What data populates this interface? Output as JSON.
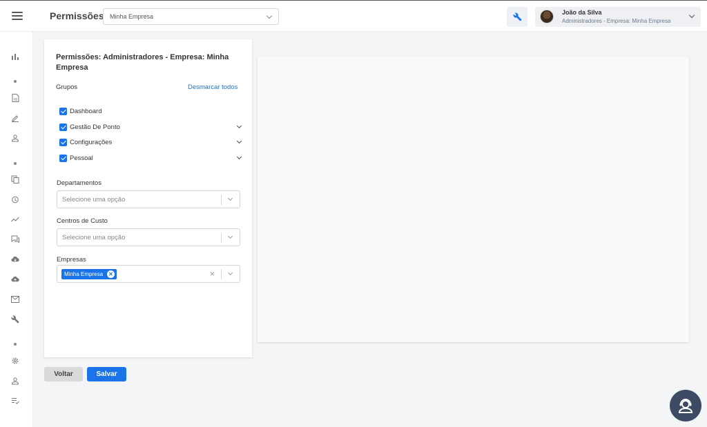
{
  "header": {
    "title": "Permissões",
    "company_select": "Minha Empresa",
    "user": {
      "name": "João da Silva",
      "role": "Administradores - Empresa: Minha Empresa"
    }
  },
  "sidebar": {
    "icons": [
      "chart-icon",
      "document-icon",
      "pencil-icon",
      "person-icon",
      "copy-icon",
      "alarm-icon",
      "trend-icon",
      "chat-icon",
      "cloud-download-icon",
      "cloud-upload-icon",
      "mail-icon",
      "wrench-icon",
      "gear-icon",
      "user-icon",
      "list-check-icon"
    ]
  },
  "card": {
    "title": "Permissões: Administradores - Empresa: Minha Empresa",
    "groups_label": "Grupos",
    "unselect_all": "Desmarcar todos",
    "groups": [
      {
        "label": "Dashboard",
        "checked": true,
        "expandable": false
      },
      {
        "label": "Gestão De Ponto",
        "checked": true,
        "expandable": true
      },
      {
        "label": "Configurações",
        "checked": true,
        "expandable": true
      },
      {
        "label": "Pessoal",
        "checked": true,
        "expandable": true
      }
    ],
    "departments": {
      "label": "Departamentos",
      "placeholder": "Selecione uma opção"
    },
    "cost_centers": {
      "label": "Centros de Custo",
      "placeholder": "Selecione uma opção"
    },
    "companies": {
      "label": "Empresas",
      "selected": [
        "Minha Empresa"
      ]
    }
  },
  "actions": {
    "back": "Voltar",
    "save": "Salvar"
  },
  "colors": {
    "primary": "#1a73e8",
    "help_button": "#3c4a63"
  }
}
